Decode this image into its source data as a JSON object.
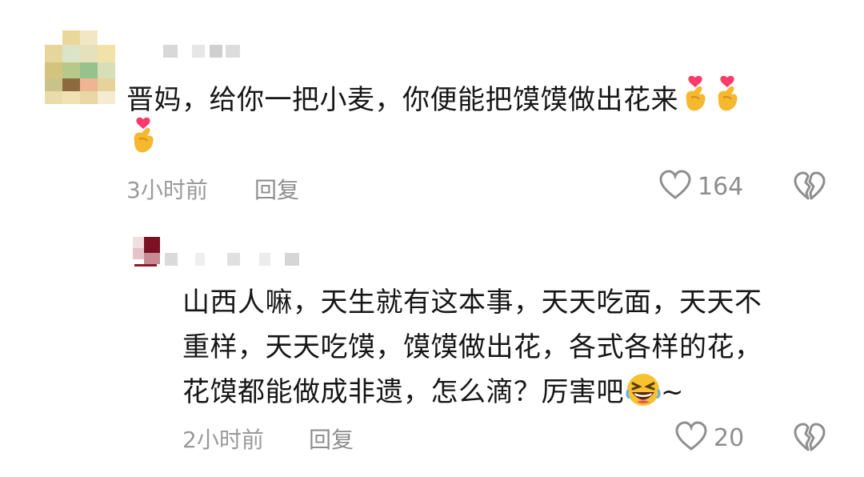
{
  "comments": [
    {
      "text": "晋妈，给你一把小麦，你便能把馍馍做出花来",
      "emojis": [
        "finger-heart-icon",
        "finger-heart-icon",
        "finger-heart-icon"
      ],
      "time": "3小时前",
      "reply_label": "回复",
      "likes": "164"
    }
  ],
  "replies": [
    {
      "lines": [
        "山西人嘛，天生就有这本事，天天吃面，天天不",
        "重样，天天吃馍，馍馍做出花，各式各样的花，",
        "花馍都能做成非遗，怎么滴？厉害吧"
      ],
      "suffix": "~",
      "emoji": "laughing-face-icon",
      "time": "2小时前",
      "reply_label": "回复",
      "likes": "20"
    }
  ],
  "colors": {
    "text": "#161616",
    "meta": "#9a9a9a",
    "icon": "#8e8e8e"
  }
}
